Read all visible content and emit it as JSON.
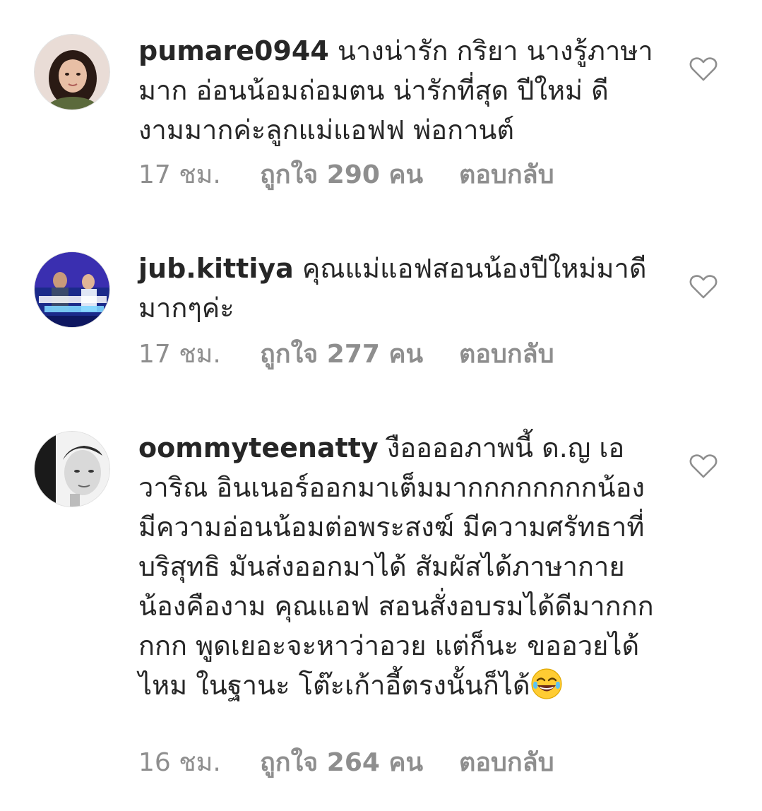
{
  "comments": [
    {
      "username": "pumare0944",
      "text": "นางน่ารัก กริยา นางรู้ภาษามาก อ่อนน้อมถ่อมตน น่ารักที่สุด ปีใหม่ ดีงามมากค่ะลูกแม่แอฟฟ พ่อกานต์",
      "time": "17 ชม.",
      "likes": "ถูกใจ 290 คน",
      "reply": "ตอบกลับ"
    },
    {
      "username": "jub.kittiya",
      "text": "คุณแม่แอฟสอนน้องปีใหม่มาดีมากๆค่ะ",
      "time": "17 ชม.",
      "likes": "ถูกใจ 277 คน",
      "reply": "ตอบกลับ"
    },
    {
      "username": "oommyteenatty",
      "text": "งืออออภาพนี้ ด.ญ เอวาริณ อินเนอร์ออกมาเต็มมากกกกกกกกน้องมีความอ่อนน้อมต่อพระสงฆ์ มีความศรัทธาที่บริสุทธิ มันส่งออกมาได้ สัมผัสได้ภาษากายน้องคืองาม คุณแอฟ สอนสั่งอบรมได้ดีมากกกกกก พูดเยอะจะหาว่าอวย แต่ก็นะ ขออวยได้ไหม ในฐานะ โต๊ะเก้าอี้ตรงนั้นก็ได้",
      "time": "16 ชม.",
      "likes": "ถูกใจ 264 คน",
      "reply": "ตอบกลับ"
    }
  ],
  "icons": {
    "like": "heart-outline-icon",
    "emoji": "face-with-tears-of-joy-icon"
  },
  "colors": {
    "text": "#262626",
    "meta": "#8e8e8e",
    "heart_stroke": "#8e8e8e"
  }
}
